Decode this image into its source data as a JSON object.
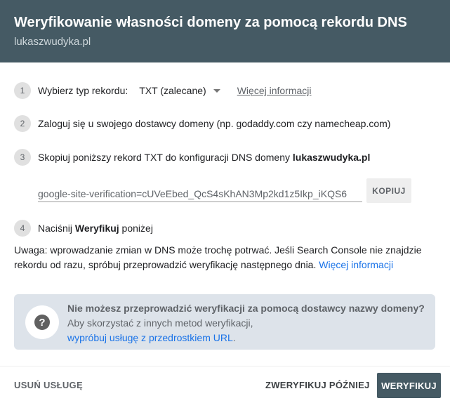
{
  "header": {
    "title": "Weryfikowanie własności domeny za pomocą rekordu DNS",
    "subtitle": "lukaszwudyka.pl"
  },
  "steps": [
    {
      "num": "1",
      "label": "Wybierz typ rekordu:",
      "record_type": "TXT (zalecane)",
      "more_info": "Więcej informacji"
    },
    {
      "num": "2",
      "text": "Zaloguj się u swojego dostawcy domeny (np. godaddy.com czy namecheap.com)"
    },
    {
      "num": "3",
      "text": "Skopiuj poniższy rekord TXT do konfiguracji DNS domeny ",
      "domain": "lukaszwudyka.pl"
    },
    {
      "num": "4",
      "text_before": "Naciśnij ",
      "bold": "Weryfikuj",
      "text_after": " poniżej"
    }
  ],
  "txt_record": {
    "value": "google-site-verification=cUVeEbed_QcS4sKhAN3Mp2kd1z5Ikp_iKQS6",
    "copy_label": "KOPIUJ"
  },
  "note": {
    "text": "Uwaga: wprowadzanie zmian w DNS może trochę potrwać. Jeśli Search Console nie znajdzie rekordu od razu, spróbuj przeprowadzić weryfikację następnego dnia. ",
    "link": "Więcej informacji"
  },
  "info_box": {
    "icon": "help-icon",
    "title": "Nie możesz przeprowadzić weryfikacji za pomocą dostawcy nazwy domeny?",
    "line2": "Aby skorzystać z innych metod weryfikacji,",
    "link": "wypróbuj usługę z przedrostkiem URL",
    "link_suffix": "."
  },
  "footer": {
    "remove": "USUŃ USŁUGĘ",
    "later": "ZWERYFIKUJ PÓŹNIEJ",
    "verify": "WERYFIKUJ"
  },
  "colors": {
    "header_bg": "#455a64",
    "link_blue": "#1a73e8",
    "info_bg": "#dde3ea"
  }
}
